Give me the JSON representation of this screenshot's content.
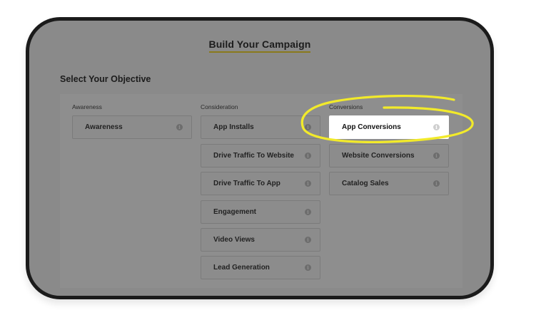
{
  "page": {
    "title": "Build Your Campaign",
    "section_heading": "Select Your Objective"
  },
  "columns": [
    {
      "label": "Awareness",
      "options": [
        {
          "label": "Awareness",
          "selected": false
        }
      ]
    },
    {
      "label": "Consideration",
      "options": [
        {
          "label": "App Installs",
          "selected": false
        },
        {
          "label": "Drive Traffic To Website",
          "selected": false
        },
        {
          "label": "Drive Traffic To App",
          "selected": false
        },
        {
          "label": "Engagement",
          "selected": false
        },
        {
          "label": "Video Views",
          "selected": false
        },
        {
          "label": "Lead Generation",
          "selected": false
        }
      ]
    },
    {
      "label": "Conversions",
      "options": [
        {
          "label": "App Conversions",
          "selected": true
        },
        {
          "label": "Website Conversions",
          "selected": false
        },
        {
          "label": "Catalog Sales",
          "selected": false
        }
      ]
    }
  ],
  "icons": {
    "info": "info-icon",
    "info_glyph": "i"
  },
  "colors": {
    "overlay_gray": "#8a8a8a",
    "highlight_yellow": "#f2ea2a",
    "title_underline": "#8a7a1c",
    "selected_bg": "#ffffff"
  }
}
